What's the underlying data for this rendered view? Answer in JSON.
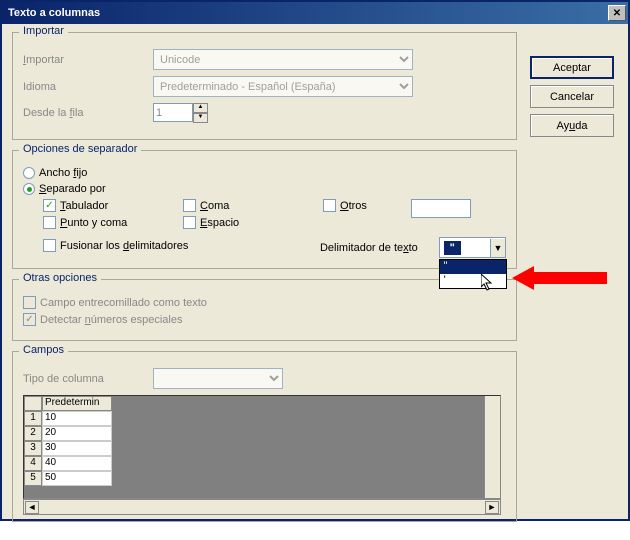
{
  "window": {
    "title": "Texto a columnas"
  },
  "buttons": {
    "ok": "Aceptar",
    "cancel": "Cancelar",
    "help": "Ayuda"
  },
  "import": {
    "group": "Importar",
    "import_label": "Importar",
    "import_value": "Unicode",
    "language_label": "Idioma",
    "language_value": "Predeterminado - Español (España)",
    "from_row_label": "Desde la fila",
    "from_row_value": "1"
  },
  "separator": {
    "group": "Opciones de separador",
    "fixed": "Ancho fijo",
    "fixed_u": "f",
    "sep": "Separado por",
    "sep_u": "S",
    "tab": "Tabulador",
    "tab_u": "T",
    "comma": "Coma",
    "comma_u": "C",
    "other": "Otros",
    "other_u": "O",
    "semi": "Punto y coma",
    "semi_u": "P",
    "space": "Espacio",
    "space_u": "E",
    "merge": "Fusionar los delimitadores",
    "merge_u": "d",
    "text_delim": "Delimitador de texto",
    "text_delim_u": "x",
    "text_delim_value": "\""
  },
  "other": {
    "group": "Otras opciones",
    "quoted": "Campo entrecomillado como texto",
    "special": "Detectar números especiales",
    "special_u": "n"
  },
  "fields": {
    "group": "Campos",
    "coltype": "Tipo de columna",
    "header": "Predetermin",
    "rows": [
      {
        "n": "1",
        "v": "10"
      },
      {
        "n": "2",
        "v": "20"
      },
      {
        "n": "3",
        "v": "30"
      },
      {
        "n": "4",
        "v": "40"
      },
      {
        "n": "5",
        "v": "50"
      }
    ]
  },
  "dropdown_options": [
    "\"",
    "'"
  ]
}
